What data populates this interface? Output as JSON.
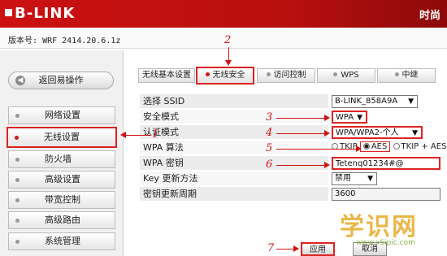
{
  "header": {
    "brand": "B-LINK",
    "right_text": "时尚"
  },
  "version": {
    "label": "版本号:",
    "value": "WRF 2414.20.6.1z"
  },
  "sidebar": {
    "back_label": "返回易操作",
    "items": [
      {
        "label": "网络设置"
      },
      {
        "label": "无线设置"
      },
      {
        "label": "防火墙"
      },
      {
        "label": "高级设置"
      },
      {
        "label": "带宽控制"
      },
      {
        "label": "高级路由"
      },
      {
        "label": "系统管理"
      }
    ]
  },
  "tabs": [
    {
      "label": "无线基本设置"
    },
    {
      "label": "无线安全"
    },
    {
      "label": "访问控制"
    },
    {
      "label": "WPS"
    },
    {
      "label": "中继"
    }
  ],
  "form": {
    "ssid_label": "选择 SSID",
    "ssid_value": "B-LINK_858A9A",
    "security_label": "安全模式",
    "security_value": "WPA",
    "auth_label": "认证模式",
    "auth_value": "WPA/WPA2-个人",
    "algo_label": "WPA 算法",
    "algo_opts": [
      "TKIP",
      "AES",
      "TKIP + AES"
    ],
    "key_label": "WPA 密钥",
    "key_value": "Tetenq01234#@",
    "update_label": "Key 更新方法",
    "update_value": "禁用",
    "period_label": "密钥更新周期",
    "period_value": "3600"
  },
  "buttons": {
    "apply": "应用",
    "cancel": "取消"
  },
  "annotations": [
    "1",
    "2",
    "3",
    "4",
    "5",
    "6",
    "7"
  ],
  "watermark": {
    "text": "学识网",
    "url": "www.xSipic.com"
  },
  "colors": {
    "header": "#cc1111",
    "annotation": "#d01010",
    "watermark": "#e6aa28"
  }
}
